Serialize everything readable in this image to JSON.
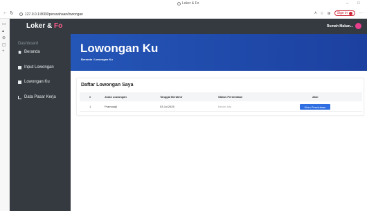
{
  "browser": {
    "tab_title": "Loker & Fo",
    "url": "127.0.0.1:8000/perusahaan/lowongan",
    "signin_label": "Sign in"
  },
  "app": {
    "brand_main": "Loker & ",
    "brand_accent": "Fo",
    "user_name": "Rumah Makan..."
  },
  "sidebar": {
    "heading": "Dashboard",
    "items": [
      {
        "label": "Beranda"
      },
      {
        "label": "Input Lowongan"
      },
      {
        "label": "Lowongan Ku"
      },
      {
        "label": "Data Pasar Kerja"
      }
    ]
  },
  "banner": {
    "title": "Lowongan Ku",
    "breadcrumb": "Beranda / Lowongan Ku"
  },
  "table": {
    "title": "Daftar Lowongan Saya",
    "headers": [
      "#",
      "Judul Lowongan",
      "Tanggal Berakhir",
      "Status Permintaan",
      "Aksi"
    ],
    "rows": [
      {
        "no": "1",
        "judul": "Pramusaji",
        "tanggal": "03 Jul 2025",
        "status": "Belum ada",
        "aksi": "Kirim Permintaan"
      }
    ]
  },
  "colors": {
    "header_bg": "#343a40",
    "banner": "#2456b7",
    "accent": "#ff5c8a",
    "button": "#2f6fe2"
  }
}
